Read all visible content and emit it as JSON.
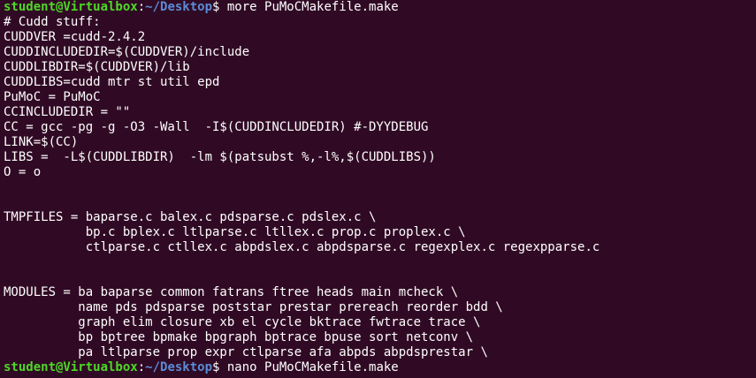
{
  "colors": {
    "background": "#300a24",
    "text": "#ffffff",
    "prompt_user": "#4ed826",
    "prompt_path": "#5b8bd6"
  },
  "prompt_top": {
    "user_host": "student@Virtualbox",
    "sep": ":",
    "path": "~/Desktop",
    "symbol": "$ ",
    "command": "more PuMoCMakefile.make"
  },
  "output_lines": [
    "# Cudd stuff:",
    "CUDDVER =cudd-2.4.2",
    "CUDDINCLUDEDIR=$(CUDDVER)/include",
    "CUDDLIBDIR=$(CUDDVER)/lib",
    "CUDDLIBS=cudd mtr st util epd",
    "PuMoC = PuMoC",
    "CCINCLUDEDIR = \"\"",
    "CC = gcc -pg -g -O3 -Wall  -I$(CUDDINCLUDEDIR) #-DYYDEBUG",
    "LINK=$(CC)",
    "LIBS =  -L$(CUDDLIBDIR)  -lm $(patsubst %,-l%,$(CUDDLIBS))",
    "O = o",
    "",
    "",
    "TMPFILES = baparse.c balex.c pdsparse.c pdslex.c \\",
    "           bp.c bplex.c ltlparse.c ltllex.c prop.c proplex.c \\",
    "           ctlparse.c ctllex.c abpdslex.c abpdsparse.c regexplex.c regexpparse.c",
    "",
    "",
    "MODULES = ba baparse common fatrans ftree heads main mcheck \\",
    "          name pds pdsparse poststar prestar prereach reorder bdd \\",
    "          graph elim closure xb el cycle bktrace fwtrace trace \\",
    "          bp bptree bpmake bpgraph bptrace bpuse sort netconv \\",
    "          pa ltlparse prop expr ctlparse afa abpds abpdsprestar \\"
  ],
  "prompt_bottom": {
    "user_host": "student@Virtualbox",
    "sep": ":",
    "path": "~/Desktop",
    "symbol": "$ ",
    "command": "nano PuMoCMakefile.make"
  }
}
